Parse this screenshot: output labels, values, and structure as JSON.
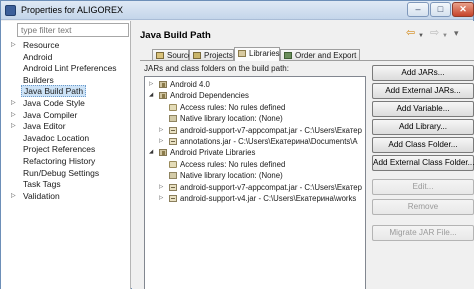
{
  "window": {
    "title": "Properties for ALIGOREX",
    "controls": {
      "minimize": "–",
      "maximize": "□",
      "close": "✕"
    }
  },
  "left_panel": {
    "filter_placeholder": "type filter text",
    "items": [
      {
        "label": "Resource",
        "expandable": true,
        "selected": false
      },
      {
        "label": "Android",
        "expandable": false,
        "selected": false
      },
      {
        "label": "Android Lint Preferences",
        "expandable": false,
        "selected": false
      },
      {
        "label": "Builders",
        "expandable": false,
        "selected": false
      },
      {
        "label": "Java Build Path",
        "expandable": false,
        "selected": true
      },
      {
        "label": "Java Code Style",
        "expandable": true,
        "selected": false
      },
      {
        "label": "Java Compiler",
        "expandable": true,
        "selected": false
      },
      {
        "label": "Java Editor",
        "expandable": true,
        "selected": false
      },
      {
        "label": "Javadoc Location",
        "expandable": false,
        "selected": false
      },
      {
        "label": "Project References",
        "expandable": false,
        "selected": false
      },
      {
        "label": "Refactoring History",
        "expandable": false,
        "selected": false
      },
      {
        "label": "Run/Debug Settings",
        "expandable": false,
        "selected": false
      },
      {
        "label": "Task Tags",
        "expandable": false,
        "selected": false
      },
      {
        "label": "Validation",
        "expandable": true,
        "selected": false
      }
    ]
  },
  "main": {
    "title": "Java Build Path",
    "nav_icons": [
      "back-arrow-icon",
      "dropdown-icon",
      "forward-arrow-icon",
      "dropdown-icon",
      "view-menu-icon"
    ],
    "tabs": [
      {
        "label": "Source",
        "active": false
      },
      {
        "label": "Projects",
        "active": false
      },
      {
        "label": "Libraries",
        "active": true
      },
      {
        "label": "Order and Export",
        "active": false
      }
    ],
    "caption": "JARs and class folders on the build path:",
    "tree": [
      {
        "text": "Android 4.0",
        "level": 0,
        "expand": "closed",
        "icon": "library"
      },
      {
        "text": "Android Dependencies",
        "level": 0,
        "expand": "open",
        "icon": "library"
      },
      {
        "text": "Access rules: No rules defined",
        "level": 1,
        "expand": "none",
        "icon": "rule"
      },
      {
        "text": "Native library location: (None)",
        "level": 1,
        "expand": "none",
        "icon": "native"
      },
      {
        "text": "android-support-v7-appcompat.jar - C:\\Users\\Екатер",
        "level": 1,
        "expand": "closed",
        "icon": "jar"
      },
      {
        "text": "annotations.jar - C:\\Users\\Екатерина\\Documents\\A",
        "level": 1,
        "expand": "closed",
        "icon": "jar"
      },
      {
        "text": "Android Private Libraries",
        "level": 0,
        "expand": "open",
        "icon": "library"
      },
      {
        "text": "Access rules: No rules defined",
        "level": 1,
        "expand": "none",
        "icon": "rule"
      },
      {
        "text": "Native library location: (None)",
        "level": 1,
        "expand": "none",
        "icon": "native"
      },
      {
        "text": "android-support-v7-appcompat.jar - C:\\Users\\Екатер",
        "level": 1,
        "expand": "closed",
        "icon": "jar"
      },
      {
        "text": "android-support-v4.jar - C:\\Users\\Екатерина\\works",
        "level": 1,
        "expand": "closed",
        "icon": "jar"
      }
    ],
    "buttons": [
      {
        "label": "Add JARs...",
        "enabled": true
      },
      {
        "label": "Add External JARs...",
        "enabled": true
      },
      {
        "label": "Add Variable...",
        "enabled": true
      },
      {
        "label": "Add Library...",
        "enabled": true
      },
      {
        "label": "Add Class Folder...",
        "enabled": true
      },
      {
        "label": "Add External Class Folder...",
        "enabled": true
      },
      {
        "label": "Edit...",
        "enabled": false
      },
      {
        "label": "Remove",
        "enabled": false
      },
      {
        "label": "Migrate JAR File...",
        "enabled": false
      }
    ]
  },
  "colors": {
    "selection": "#cde3f7",
    "window_border": "#6d8fb8",
    "back_arrow": "#d38a1a"
  }
}
